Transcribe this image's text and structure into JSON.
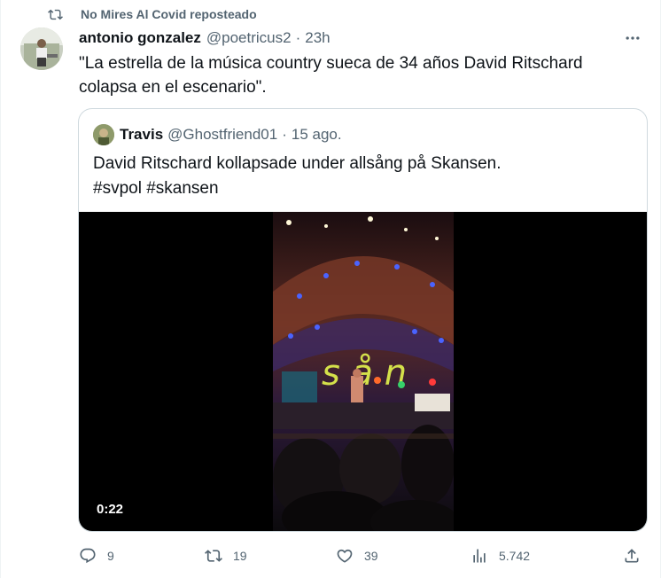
{
  "repost": {
    "label": "No Mires Al Covid reposteado",
    "icon": "repost-icon"
  },
  "tweet": {
    "author_name": "antonio gonzalez",
    "author_handle": "@poetricus2",
    "separator": "·",
    "time": "23h",
    "text": "\"La estrella de la música country sueca de 34 años David Ritschard colapsa en el escenario\".",
    "more_icon": "more-dots-icon"
  },
  "quote": {
    "author_name": "Travis",
    "author_handle": "@Ghostfriend01",
    "separator": "·",
    "time": "15 ago.",
    "text_line1": "David Ritschard kollapsade under allsång på Skansen.",
    "text_line2": "#svpol #skansen",
    "video_duration": "0:22"
  },
  "actions": {
    "replies": "9",
    "reposts": "19",
    "likes": "39",
    "views": "5.742",
    "icons": [
      "reply-icon",
      "repost-icon",
      "like-icon",
      "views-icon",
      "share-icon"
    ]
  },
  "colors": {
    "text_primary": "#0f1419",
    "text_secondary": "#536471",
    "border": "#cfd9de",
    "media_bg": "#000000"
  }
}
